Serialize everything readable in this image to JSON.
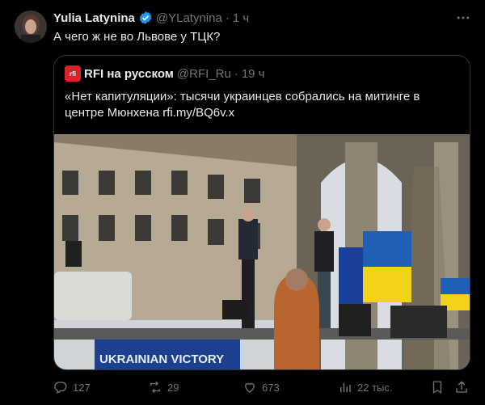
{
  "author": {
    "name": "Yulia Latynina",
    "handle": "@YLatynina",
    "time": "1 ч",
    "text": "А чего ж не во Львове у ТЦК?"
  },
  "quoted": {
    "name": "RFI на русском",
    "handle": "@RFI_Ru",
    "time": "19 ч",
    "logo_text": "rfi",
    "text": "«Нет капитуляции»: тысячи украинцев собрались на митинге в центре Мюнхена rfi.my/BQ6v.x",
    "banner_text": "UKRAINIAN VICTORY"
  },
  "actions": {
    "replies": "127",
    "retweets": "29",
    "likes": "673",
    "views": "22 тыс."
  },
  "icons": [
    "verified-badge-icon",
    "more-icon",
    "reply-icon",
    "retweet-icon",
    "like-icon",
    "views-icon",
    "bookmark-icon",
    "share-icon"
  ],
  "colors": {
    "verified": "#1d9bf0",
    "muted": "#71767b",
    "border": "#2f3336",
    "rfi": "#d8232a"
  }
}
